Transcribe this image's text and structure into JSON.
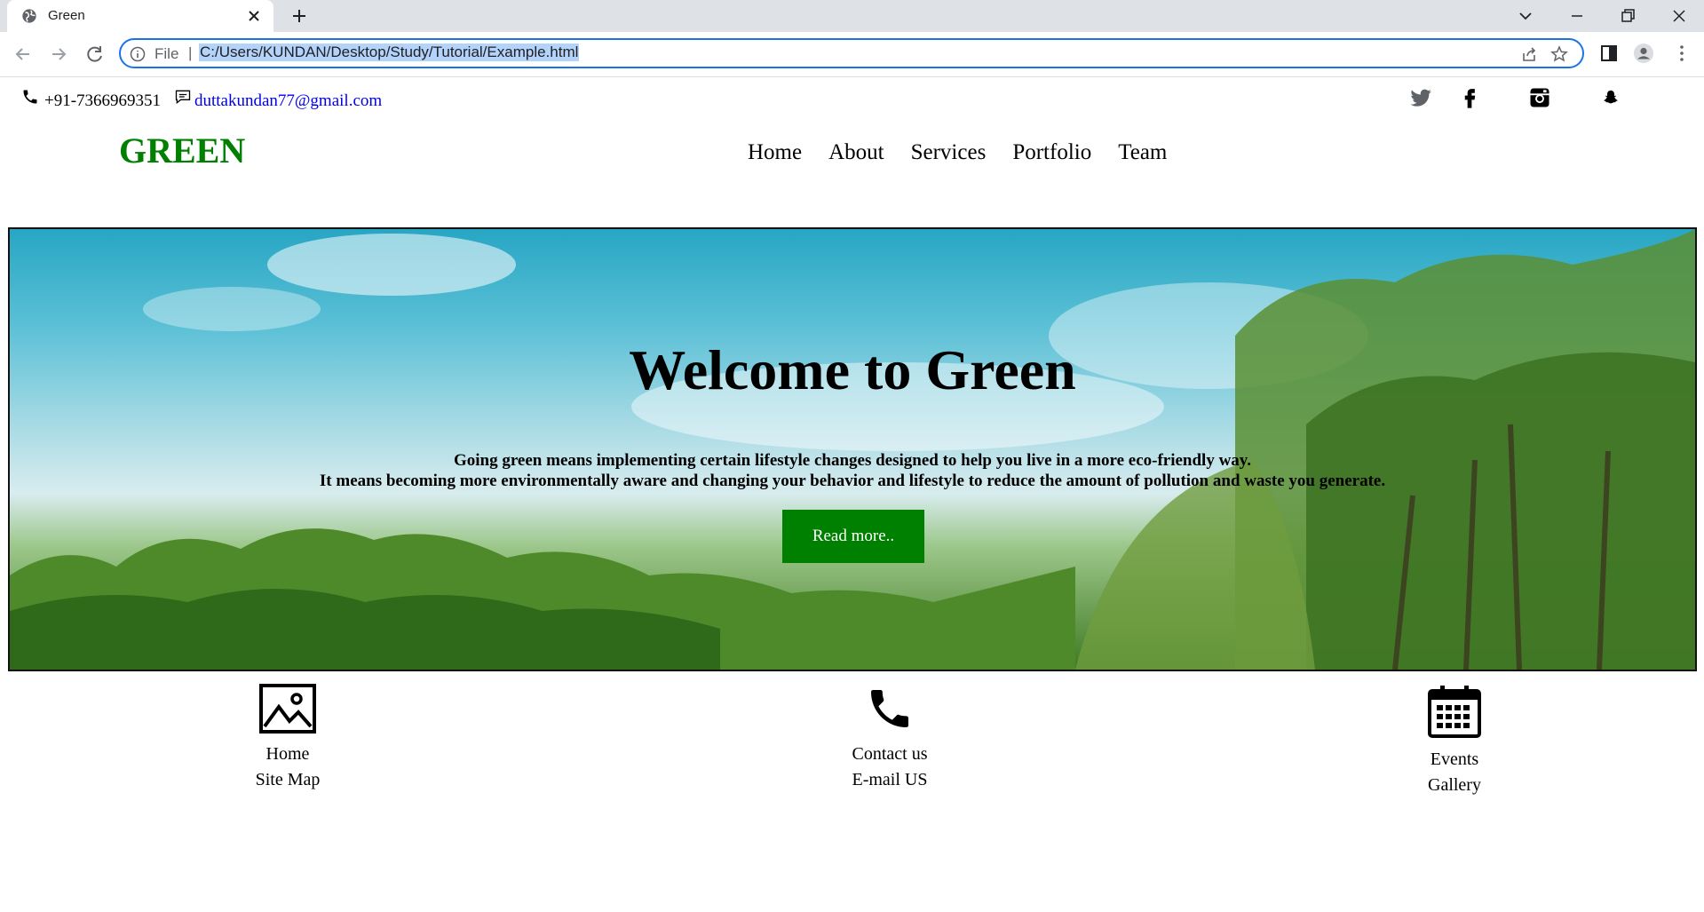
{
  "browser": {
    "tab_title": "Green",
    "omnibox_scheme": "File",
    "url": "C:/Users/KUNDAN/Desktop/Study/Tutorial/Example.html"
  },
  "topbar": {
    "phone": "+91-7366969351",
    "email": "duttakundan77@gmail.com",
    "social_icons": [
      "twitter-icon",
      "facebook-icon",
      "instagram-icon",
      "snapchat-icon"
    ]
  },
  "header": {
    "logo": "GREEN",
    "logo_color": "#008000",
    "nav": [
      "Home",
      "About",
      "Services",
      "Portfolio",
      "Team"
    ]
  },
  "hero": {
    "title": "Welcome to Green",
    "line1": "Going green means implementing certain lifestyle changes designed to help you live in a more eco-friendly way.",
    "line2": "It means becoming more environmentally aware and changing your behavior and lifestyle to reduce the amount of pollution and waste you generate.",
    "button": "Read more..",
    "button_color": "#008000"
  },
  "features": [
    {
      "icon": "image-icon",
      "line1": "Home",
      "line2": "Site Map"
    },
    {
      "icon": "phone-icon",
      "line1": "Contact us",
      "line2": "E-mail US"
    },
    {
      "icon": "calendar-icon",
      "line1": "Events",
      "line2": "Gallery"
    }
  ]
}
